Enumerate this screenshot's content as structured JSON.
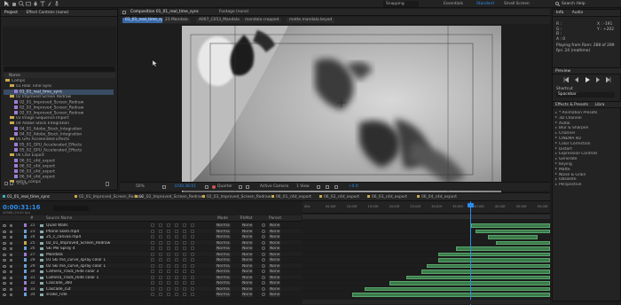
{
  "topbar": {
    "workspaces": [
      "Essentials",
      "Standard",
      "Small Screen"
    ],
    "active_workspace": "Standard",
    "search_placeholder": "Search Help",
    "dropdown_label": "Snapping"
  },
  "project_panel": {
    "tabs": [
      "Project",
      "Effect Controls (none)"
    ],
    "column_header": "Name",
    "items": [
      {
        "label": "Comps",
        "type": "folder",
        "depth": 0
      },
      {
        "label": "01 Real Time Sync",
        "type": "folder",
        "depth": 1
      },
      {
        "label": "01_01_real_time_sync",
        "type": "comp",
        "depth": 2,
        "selected": true
      },
      {
        "label": "02 Improved Screen Redraw",
        "type": "folder",
        "depth": 1
      },
      {
        "label": "02_01_Improved_Screen_Redraw",
        "type": "comp",
        "depth": 2
      },
      {
        "label": "02_02_Improved_Screen_Redraw",
        "type": "comp",
        "depth": 2
      },
      {
        "label": "02_03_Improved_Screen_Redraw",
        "type": "comp",
        "depth": 2
      },
      {
        "label": "03 Image Sequence Import",
        "type": "folder",
        "depth": 1
      },
      {
        "label": "04 Adobe Stock Integration",
        "type": "folder",
        "depth": 1
      },
      {
        "label": "04_01_Adobe_Stock_Integration",
        "type": "comp",
        "depth": 2
      },
      {
        "label": "04_02_Adobe_Stock_Integration",
        "type": "comp",
        "depth": 2
      },
      {
        "label": "05 GPU Accelerated Effects",
        "type": "folder",
        "depth": 1
      },
      {
        "label": "05_01_GPU_Accelerated_Effects",
        "type": "comp",
        "depth": 2
      },
      {
        "label": "05_02_GPU_Accelerated_Effects",
        "type": "comp",
        "depth": 2
      },
      {
        "label": "06 C4D Export",
        "type": "folder",
        "depth": 1
      },
      {
        "label": "06_01_c4d_export",
        "type": "comp",
        "depth": 2
      },
      {
        "label": "06_02_c4d_export",
        "type": "comp",
        "depth": 2
      },
      {
        "label": "06_03_c4d_export",
        "type": "comp",
        "depth": 2
      },
      {
        "label": "06_04_c4d_export",
        "type": "comp",
        "depth": 2
      },
      {
        "label": "extra_comps",
        "type": "folder",
        "depth": 1
      }
    ],
    "footer": "8 bpc"
  },
  "comp_panel": {
    "tabs": [
      "Composition 01_01_real_time_sync",
      "Footage (none)"
    ],
    "active_tab": "Composition 01_01_real_time_sync",
    "breadcrumbs": [
      "01_01_real_time_sync",
      "23 Mandala",
      "A007_C053_Mandala",
      "mandala cropped",
      "matte mandala keyed"
    ],
    "footer": {
      "zoom": "50%",
      "timecode": "0:00:36:01",
      "resolution": "Quarter",
      "camera": "Active Camera",
      "views": "1 View",
      "exposure": "+0.0"
    }
  },
  "info_panel": {
    "tabs": [
      "Info",
      "Audio"
    ],
    "lines": [
      "R :",
      "G :",
      "B :",
      "A : 0"
    ],
    "coords": [
      "X : -191",
      "Y : +202"
    ],
    "playing": [
      "Playing from Ram: 288 of 289",
      "fps: 24 (realtime)"
    ]
  },
  "preview_panel": {
    "title": "Preview",
    "shortcut_label": "Shortcut",
    "shortcut_value": "Spacebar"
  },
  "effects_panel": {
    "tabs": [
      "Effects & Presets",
      "Libra"
    ],
    "items": [
      "* Animation Presets",
      "3D Channel",
      "Audio",
      "Blur & Sharpen",
      "Channel",
      "CINEMA 4D",
      "Color Correction",
      "Distort",
      "Expression Controls",
      "Generate",
      "Keying",
      "Matte",
      "Noise & Grain",
      "Obsolete",
      "Perspective"
    ]
  },
  "timeline": {
    "tabs": [
      "01_01_real_time_sync",
      "02_01_Improved_Screen_Redraw",
      "02_02_Improved_Screen_Redraw",
      "02_03_Improved_Screen_Redraw",
      "06_01_c4d_export",
      "06_02_c4d_export",
      "06_03_c4d_export",
      "06_04_c4d_export"
    ],
    "tab_colors": [
      "#3fb0c0",
      "#c9a94a",
      "#c9a94a",
      "#c9a94a",
      "#c9a94a",
      "#c9a94a",
      "#c9a94a",
      "#c9a94a"
    ],
    "timecode": "0:00:31:16",
    "timecode_sub": "00568 (24.00 fps)",
    "column_headers": {
      "num": "#",
      "name": "Source Name",
      "mode": "Mode",
      "trkmat": "TrkMat",
      "parent": "Parent"
    },
    "ruler_ticks": [
      "00s",
      "05:00f",
      "10:00f",
      "15:00f",
      "20:00f",
      "25:00f",
      "30:00f",
      "35:00f",
      "40:00f",
      "45:00f",
      "50:00f",
      "55:00f"
    ],
    "layers": [
      {
        "num": "22",
        "name": "Quad Walls",
        "mode": "Norma",
        "trkmat": "None",
        "parent": "None",
        "color": "#9c7cd4"
      },
      {
        "num": "23",
        "name": "Phone Slam.mp4",
        "mode": "Norma",
        "trkmat": "None",
        "parent": "None",
        "color": "#6aa0d8"
      },
      {
        "num": "24",
        "name": "25_c_canvas.mp4",
        "mode": "Norma",
        "trkmat": "None",
        "parent": "None",
        "color": "#6aa0d8"
      },
      {
        "num": "25",
        "name": "02_01_Improved_Screen_Redraw",
        "mode": "Norma",
        "trkmat": "None",
        "parent": "None",
        "color": "#c9a94a"
      },
      {
        "num": "26",
        "name": "Ski Me Spray 4",
        "mode": "Norma",
        "trkmat": "None",
        "parent": "None",
        "color": "#6aa0d8"
      },
      {
        "num": "27",
        "name": "Mandala",
        "mode": "Norma",
        "trkmat": "None",
        "parent": "None",
        "color": "#9c7cd4"
      },
      {
        "num": "28",
        "name": "01 Ski me_curve_spray color 1",
        "mode": "Norma",
        "trkmat": "None",
        "parent": "None",
        "color": "#6aa0d8"
      },
      {
        "num": "29",
        "name": "02 Ski me_curve_spray color 1",
        "mode": "Norma",
        "trkmat": "None",
        "parent": "None",
        "color": "#6aa0d8"
      },
      {
        "num": "30",
        "name": "Camera_Track_Ride color 3",
        "mode": "Norma",
        "trkmat": "None",
        "parent": "None",
        "color": "#6aa0d8"
      },
      {
        "num": "31",
        "name": "Camera_Track_Ride color 1",
        "mode": "Norma",
        "trkmat": "None",
        "parent": "None",
        "color": "#6aa0d8"
      },
      {
        "num": "32",
        "name": "Cascade_360",
        "mode": "Norma",
        "trkmat": "None",
        "parent": "None",
        "color": "#9c7cd4"
      },
      {
        "num": "33",
        "name": "Cascade_cut",
        "mode": "Norma",
        "trkmat": "None",
        "parent": "None",
        "color": "#9c7cd4"
      },
      {
        "num": "34",
        "name": "snake_ride",
        "mode": "Norma",
        "trkmat": "None",
        "parent": "None",
        "color": "#6aa0d8"
      }
    ],
    "bars": [
      {
        "start": 0.68,
        "end": 1.0
      },
      {
        "start": 0.7,
        "end": 1.0
      },
      {
        "start": 0.75,
        "end": 0.95
      },
      {
        "start": 0.78,
        "end": 1.0
      },
      {
        "start": 0.62,
        "end": 1.0
      },
      {
        "start": 0.55,
        "end": 1.0
      },
      {
        "start": 0.55,
        "end": 1.0
      },
      {
        "start": 0.5,
        "end": 1.0
      },
      {
        "start": 0.48,
        "end": 1.0
      },
      {
        "start": 0.42,
        "end": 1.0
      },
      {
        "start": 0.35,
        "end": 1.0
      },
      {
        "start": 0.25,
        "end": 1.0
      },
      {
        "start": 0.2,
        "end": 1.0
      }
    ]
  }
}
